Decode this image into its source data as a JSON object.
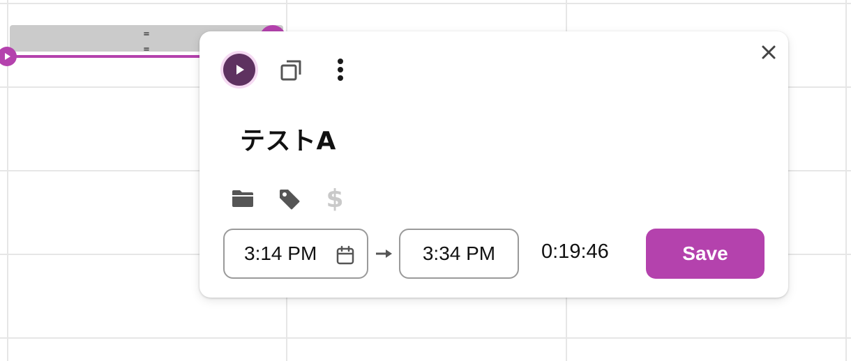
{
  "entry": {
    "handle_glyphs": [
      "=",
      "="
    ]
  },
  "popup": {
    "title": "テストA",
    "toolbar": {
      "play_icon": "play-icon",
      "duplicate_icon": "duplicate-icon",
      "more_icon": "more-vertical-icon",
      "close_icon": "close-icon"
    },
    "meta_icons": {
      "project_icon": "folder-icon",
      "tag_icon": "tag-icon",
      "billable_symbol": "$"
    },
    "start_time": "3:14 PM",
    "end_time": "3:34 PM",
    "duration": "0:19:46",
    "save_label": "Save"
  },
  "colors": {
    "accent": "#b442ad",
    "play_bg": "#5e3260",
    "play_ring": "#f5d9f2",
    "billable_inactive": "#c9c9c9"
  }
}
